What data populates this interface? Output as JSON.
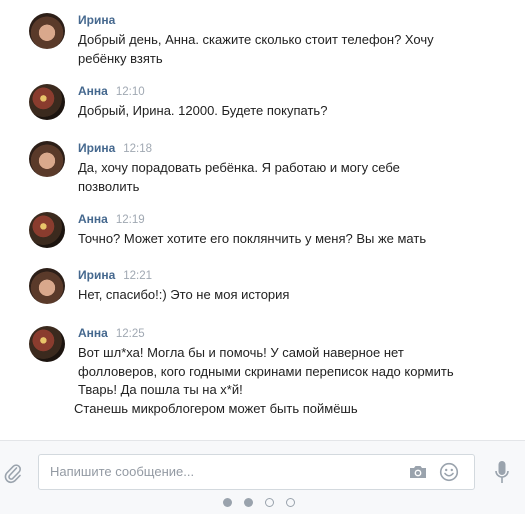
{
  "messages": [
    {
      "author": "Ирина",
      "time": "",
      "avatar": "irina",
      "lines": [
        "Добрый день, Анна. скажите сколько стоит телефон? Хочу",
        "ребёнку взять"
      ]
    },
    {
      "author": "Анна",
      "time": "12:10",
      "avatar": "anna",
      "lines": [
        "Добрый, Ирина. 12000. Будете покупать?"
      ]
    },
    {
      "author": "Ирина",
      "time": "12:18",
      "avatar": "irina",
      "lines": [
        "Да, хочу порадовать ребёнка. Я работаю и могу себе",
        "позволить"
      ]
    },
    {
      "author": "Анна",
      "time": "12:19",
      "avatar": "anna",
      "lines": [
        "Точно? Может хотите его поклянчить у меня? Вы же мать"
      ]
    },
    {
      "author": "Ирина",
      "time": "12:21",
      "avatar": "irina",
      "lines": [
        "Нет, спасибо!:) Это не моя история"
      ]
    },
    {
      "author": "Анна",
      "time": "12:25",
      "avatar": "anna",
      "lines": [
        "Вот шл*ха! Могла бы и помочь! У самой наверное нет",
        "фолловеров, кого годными скринами переписок надо кормить",
        "Тварь! Да пошла ты на х*й!",
        "Станешь микроблогером может быть поймёшь"
      ]
    }
  ],
  "input": {
    "placeholder": "Напишите сообщение..."
  },
  "icons": {
    "attach": "paperclip-icon",
    "camera": "camera-icon",
    "emoji": "smile-icon",
    "voice": "microphone-icon"
  },
  "pager": {
    "total": 4,
    "active": 2
  },
  "colors": {
    "author": "#45688e",
    "time": "#a0a8b2",
    "icon": "#9aa3ad"
  }
}
